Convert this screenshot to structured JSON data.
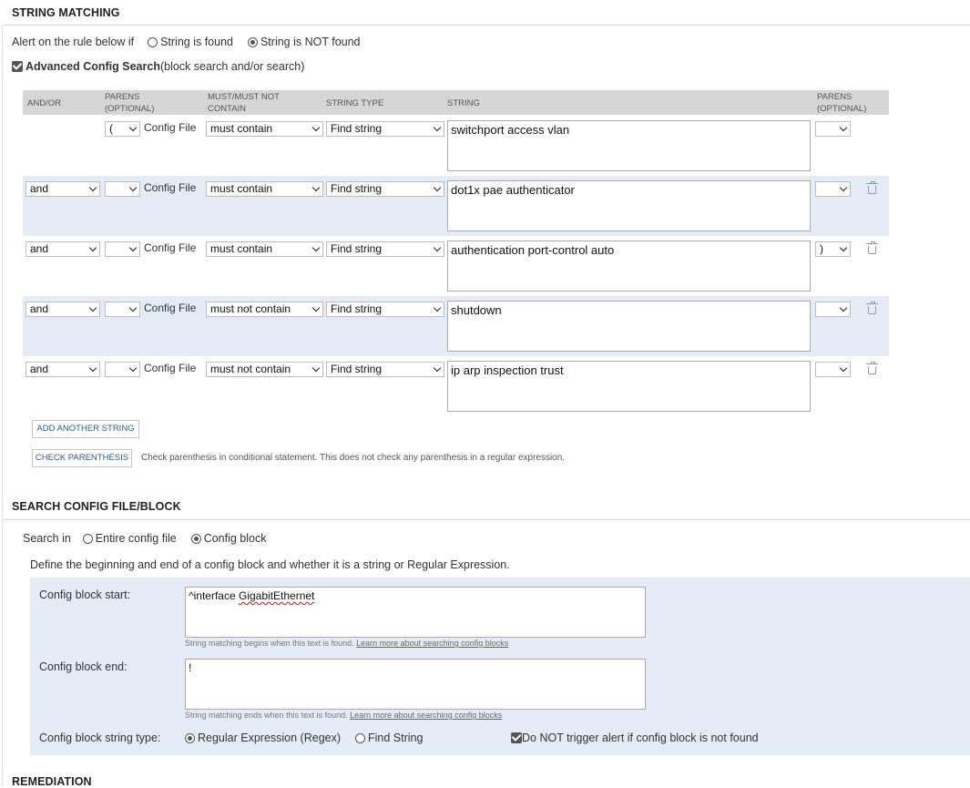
{
  "string_matching": {
    "title": "STRING MATCHING",
    "alert_prefix": "Alert on the rule below if",
    "alert_options": [
      "String is found",
      "String is NOT found"
    ],
    "alert_selected": 1,
    "advanced_label": "Advanced Config Search",
    "advanced_suffix": "(block search and/or search)",
    "advanced_checked": true,
    "headers": {
      "andor": "AND/OR",
      "parens1_a": "PARENS",
      "parens1_b": "(OPTIONAL)",
      "must_a": "MUST/MUST NOT",
      "must_b": "CONTAIN",
      "type": "STRING TYPE",
      "string": "STRING",
      "parens2_a": "PARENS",
      "parens2_b": "(OPTIONAL)"
    },
    "rows": [
      {
        "andor": "",
        "open": "(",
        "source": "Config File",
        "must": "must contain",
        "type": "Find string",
        "string": "switchport access vlan",
        "close": ""
      },
      {
        "andor": "and",
        "open": "",
        "source": "Config File",
        "must": "must contain",
        "type": "Find string",
        "string": "dot1x pae authenticator",
        "close": ""
      },
      {
        "andor": "and",
        "open": "",
        "source": "Config File",
        "must": "must contain",
        "type": "Find string",
        "string": "authentication port-control auto",
        "close": ")"
      },
      {
        "andor": "and",
        "open": "",
        "source": "Config File",
        "must": "must not contain",
        "type": "Find string",
        "string": "shutdown",
        "close": ""
      },
      {
        "andor": "and",
        "open": "",
        "source": "Config File",
        "must": "must not contain",
        "type": "Find string",
        "string": "ip arp inspection trust",
        "close": ""
      }
    ],
    "add_button": "ADD ANOTHER STRING",
    "check_button": "CHECK PARENTHESIS",
    "check_note": "Check parenthesis in conditional statement. This does not check any parenthesis in a regular expression."
  },
  "search_block": {
    "title": "SEARCH CONFIG FILE/BLOCK",
    "search_in_label": "Search in",
    "search_options": [
      "Entire config file",
      "Config block"
    ],
    "search_selected": 1,
    "define_text": "Define the beginning and end of a config block and whether it is a string or Regular Expression.",
    "start_label": "Config block start:",
    "start_value_a": "^interface ",
    "start_value_b": "GigabitEthernet",
    "start_hint": "String matching begins when this text is found.",
    "start_link": "Learn more about searching config blocks",
    "end_label": "Config block end:",
    "end_value": "!",
    "end_hint": "String matching ends when this text is found.",
    "end_link": "Learn more about searching config blocks",
    "type_label": "Config block string type:",
    "type_options": [
      "Regular Expression (Regex)",
      "Find String"
    ],
    "type_selected": 0,
    "no_trigger_label": "Do NOT trigger alert if config block is not found",
    "no_trigger_checked": true
  },
  "remediation": {
    "title": "REMEDIATION"
  }
}
